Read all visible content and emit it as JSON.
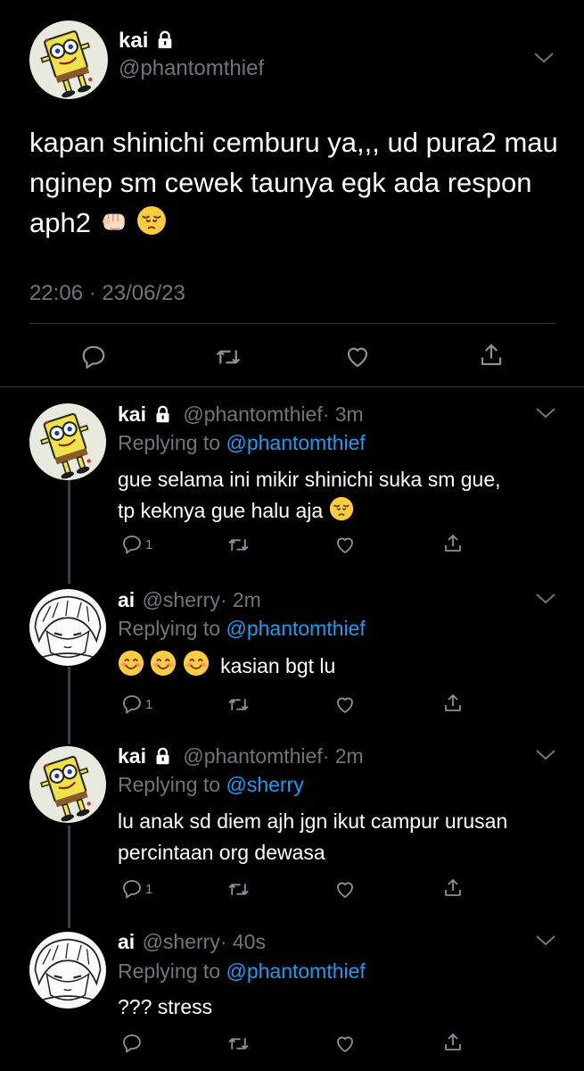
{
  "main_tweet": {
    "display_name": "kai",
    "handle": "@phantomthief",
    "text": "kapan shinichi cemburu ya,,, ud pura2 mau nginep sm cewek taunya egk ada respon aph2",
    "timestamp": "22:06 · 23/06/23"
  },
  "replies": [
    {
      "display_name": "kai",
      "handle": "@phantomthief",
      "time": "· 3m",
      "replying_label": "Replying to",
      "replying_to": "@phantomthief",
      "text_line1": "gue selama ini mikir shinichi suka sm gue,",
      "text_line2": "tp keknya gue halu aja",
      "reply_count": "1",
      "avatar": "spongebob"
    },
    {
      "display_name": "ai",
      "handle": "@sherry",
      "time": "· 2m",
      "replying_label": "Replying to",
      "replying_to": "@phantomthief",
      "text_line1": "kasian bgt lu",
      "reply_count": "1",
      "avatar": "manga-girl"
    },
    {
      "display_name": "kai",
      "handle": "@phantomthief",
      "time": "· 2m",
      "replying_label": "Replying to",
      "replying_to": "@sherry",
      "text_line1": "lu anak sd diem ajh jgn ikut campur urusan",
      "text_line2": "percintaan org dewasa",
      "reply_count": "1",
      "avatar": "spongebob"
    },
    {
      "display_name": "ai",
      "handle": "@sherry",
      "time": "· 40s",
      "replying_label": "Replying to",
      "replying_to": "@phantomthief",
      "text_line1": "??? stress",
      "reply_count": "",
      "avatar": "manga-girl"
    }
  ],
  "colors": {
    "background": "#000000",
    "link": "#1d9bf0",
    "muted": "#6e767d"
  },
  "icons": [
    "lock-icon",
    "chevron-down-icon",
    "reply-icon",
    "retweet-icon",
    "like-icon",
    "share-icon",
    "fist-emoji",
    "pensive-emoji",
    "smile-emoji"
  ]
}
